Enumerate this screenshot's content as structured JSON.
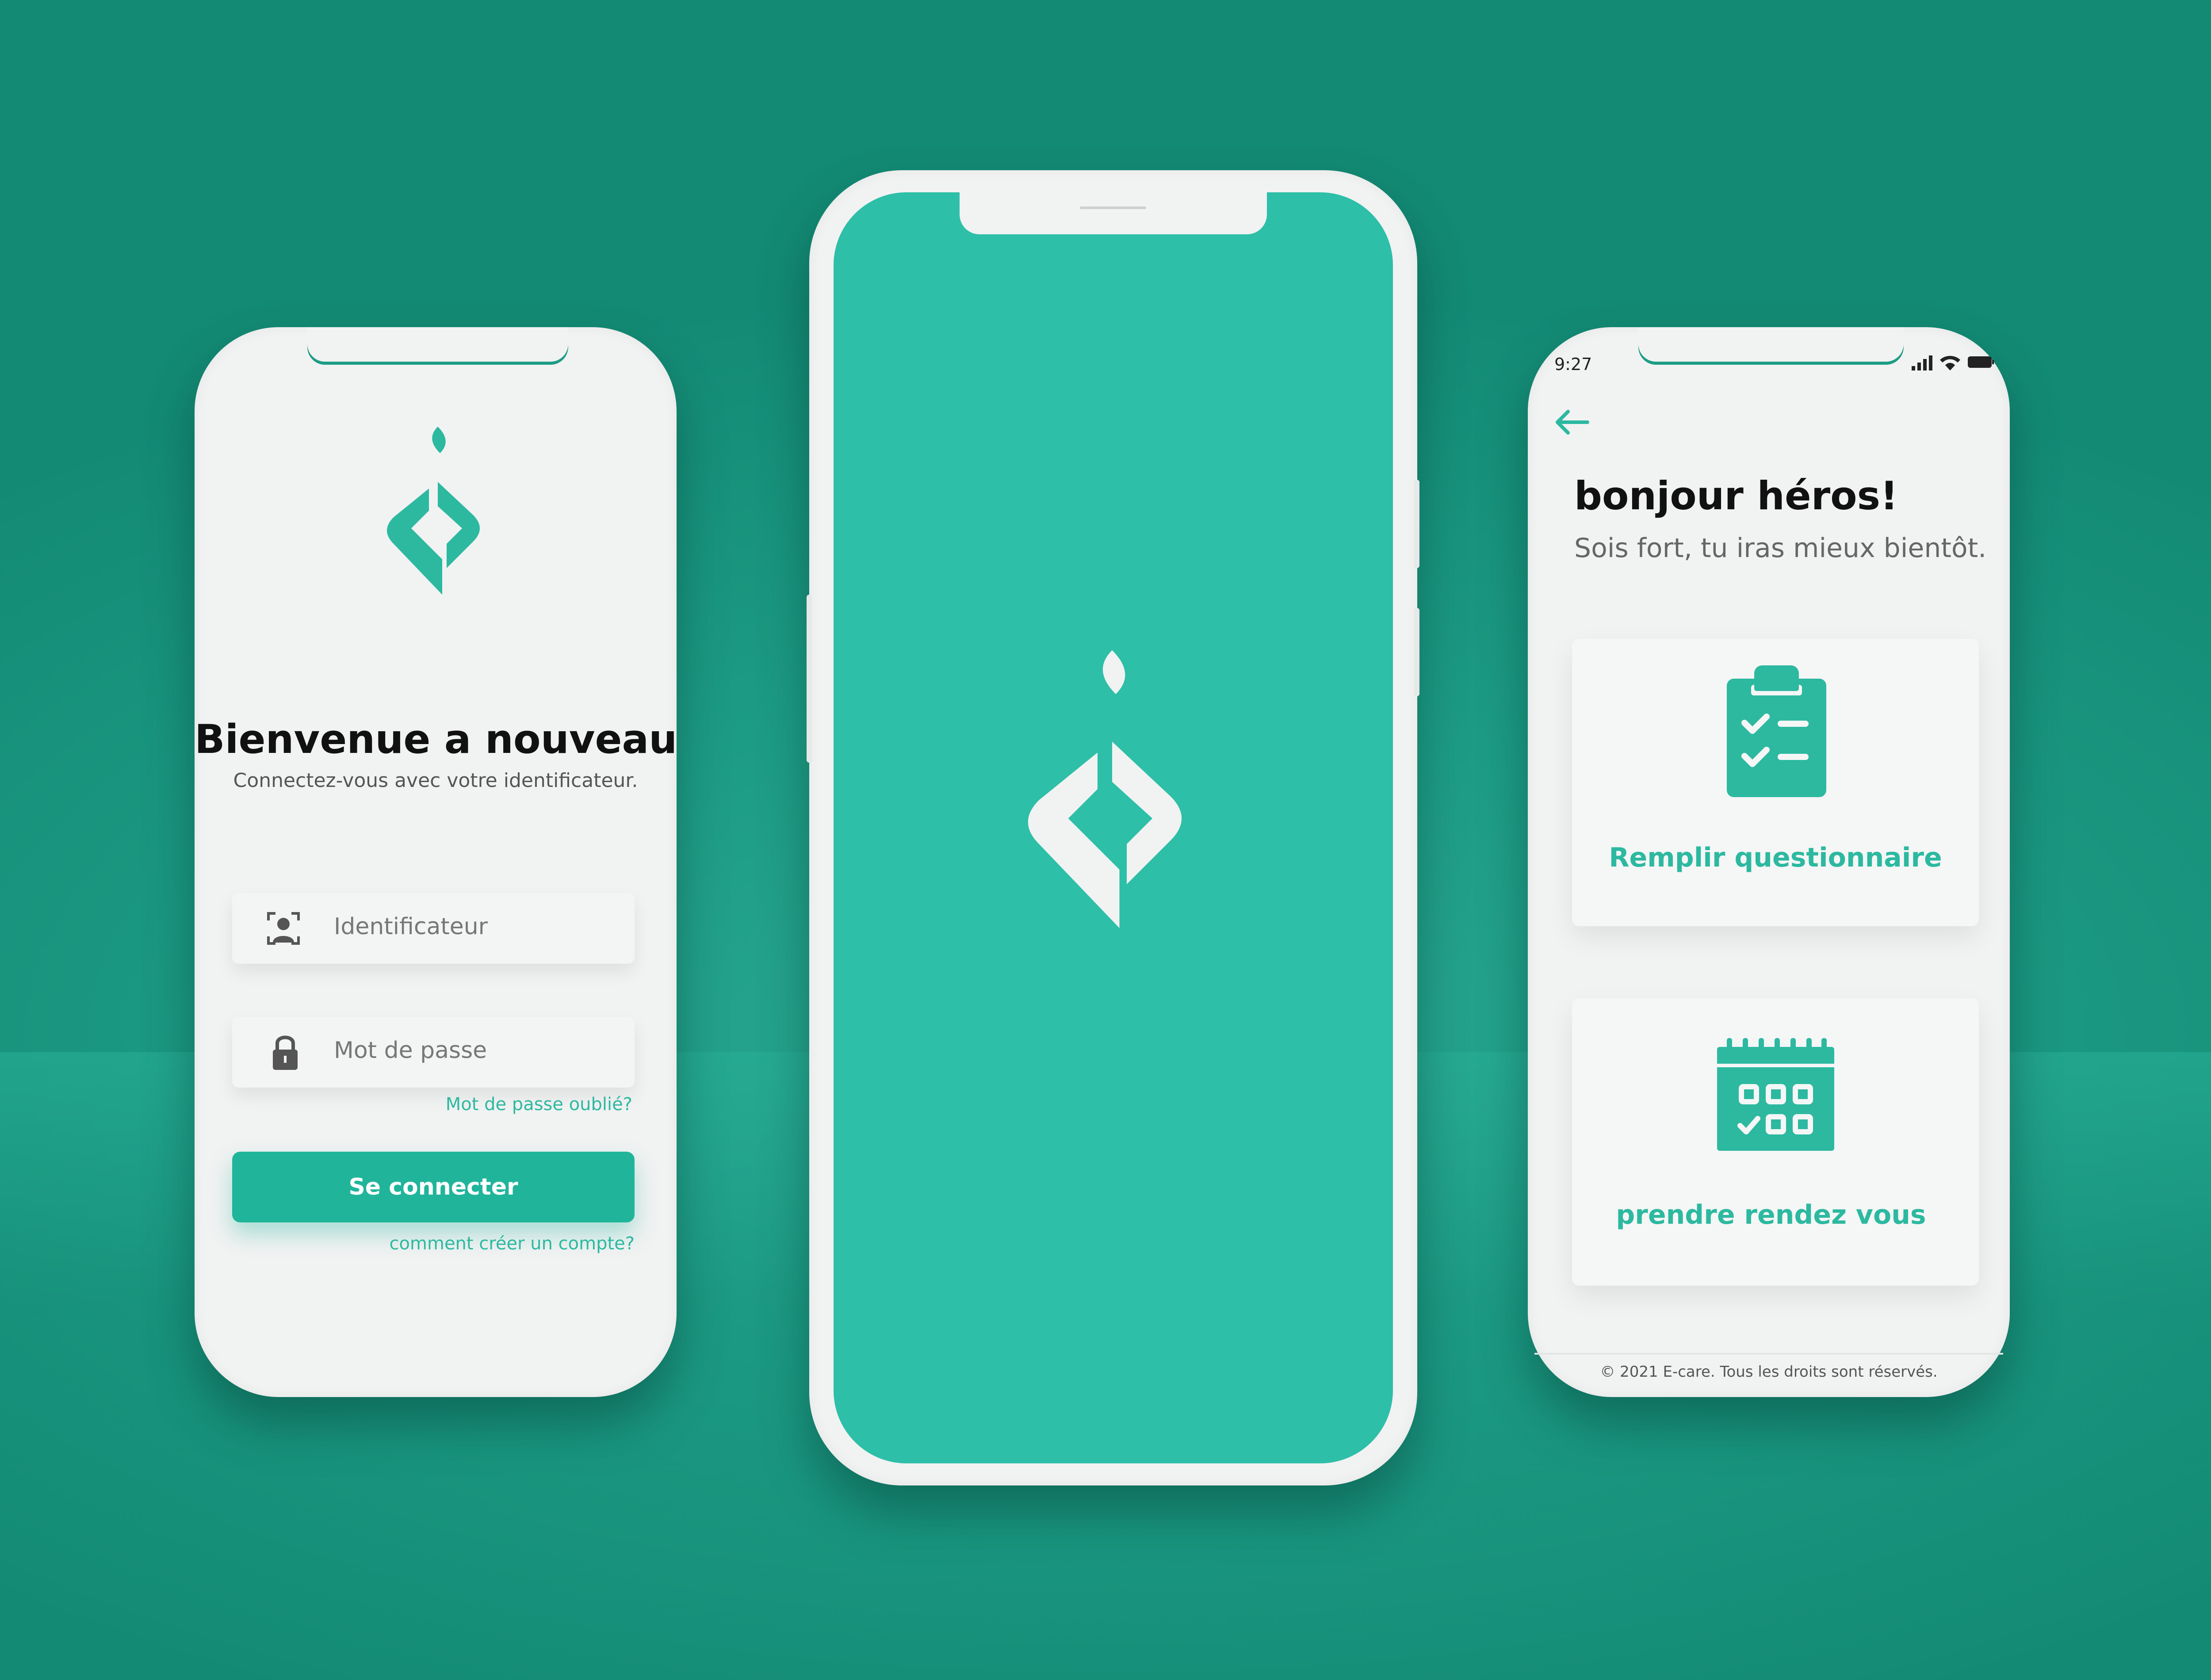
{
  "colors": {
    "accent": "#2cb9a0",
    "button": "#20b59b",
    "background": "#1d9c85",
    "splash": "#2dbfa8"
  },
  "login": {
    "title": "Bienvenue a nouveau",
    "subtitle": "Connectez-vous avec votre identificateur.",
    "id_placeholder": "Identificateur",
    "password_placeholder": "Mot de passe",
    "forgot_password": "Mot de passe oublié?",
    "submit_label": "Se connecter",
    "create_account": "comment créer un compte?"
  },
  "home": {
    "status_time": "9:27",
    "greeting": "bonjour héros!",
    "subtitle": "Sois fort, tu iras mieux bientôt.",
    "card_questionnaire": "Remplir questionnaire",
    "card_appointment": "prendre rendez vous",
    "footer": "© 2021 E-care. Tous les droits sont réservés."
  },
  "icons": {
    "logo": "ecare-logo-icon",
    "id": "face-id-icon",
    "lock": "lock-icon",
    "back": "arrow-left-icon",
    "questionnaire": "clipboard-check-icon",
    "calendar": "calendar-icon"
  }
}
